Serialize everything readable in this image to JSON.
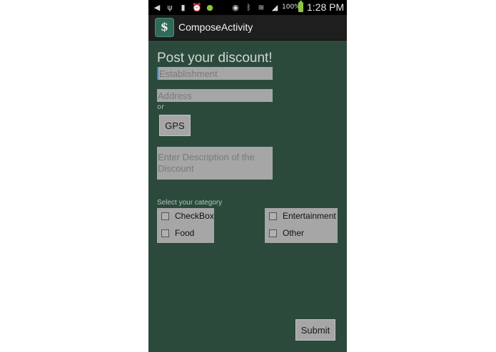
{
  "status_bar": {
    "battery_percent": "100%",
    "time": "1:28 PM",
    "icons": [
      "back-notification-icon",
      "usb-icon",
      "battery-notification-icon",
      "alarm-icon",
      "android-icon",
      "eye-icon",
      "bluetooth-icon",
      "wifi-icon",
      "signal-icon",
      "battery-icon"
    ]
  },
  "action_bar": {
    "title": "ComposeActivity",
    "icon": "app-logo-icon"
  },
  "form": {
    "heading": "Post your discount!",
    "establishment_placeholder": "Establishment",
    "address_placeholder": "Address",
    "or_label": "or",
    "gps_label": "GPS",
    "description_placeholder": "Enter Description of the Discount",
    "category_label": "Select your category",
    "categories_left": [
      "CheckBox",
      "Food"
    ],
    "categories_right": [
      "Entertainment",
      "Other"
    ],
    "submit_label": "Submit"
  },
  "colors": {
    "background": "#2c4a3c",
    "field": "#a6a6a6",
    "status_bar": "#000000",
    "action_bar": "#1e1e1e",
    "focus_accent": "#2f8bd6"
  }
}
